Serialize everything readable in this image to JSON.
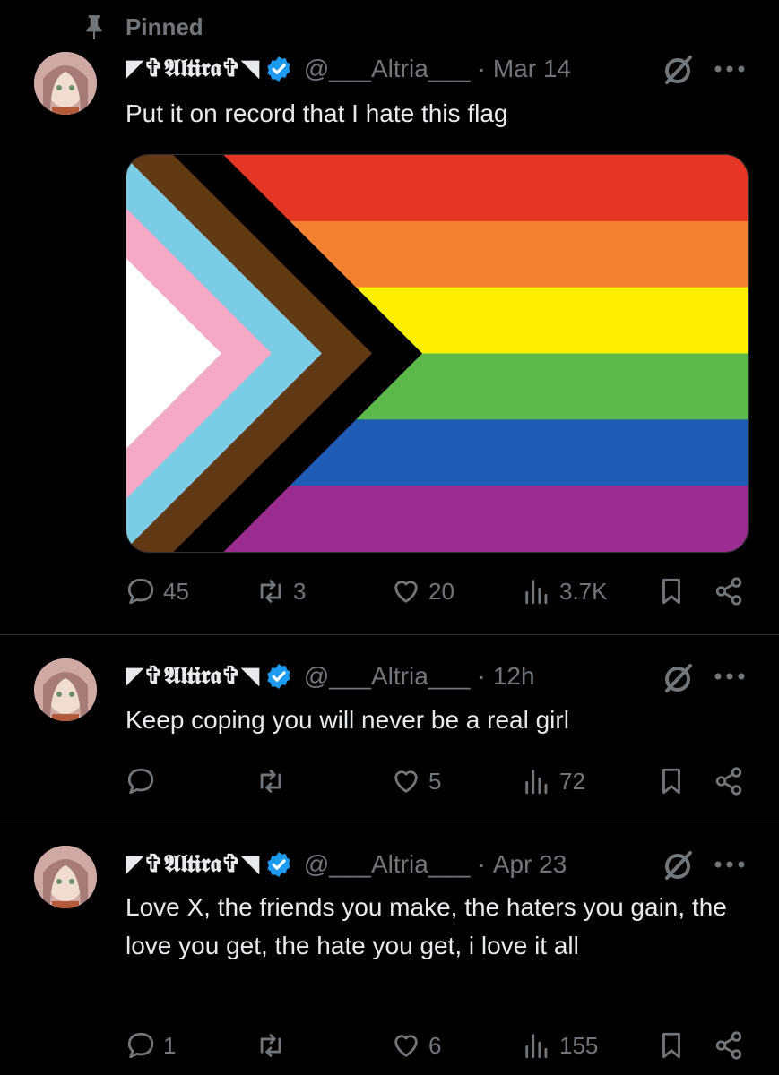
{
  "pinned_label": "Pinned",
  "colors": {
    "accent_verified": "#1d9bf0",
    "muted": "#71767b",
    "text": "#e7e9ea",
    "background": "#000000"
  },
  "flag": {
    "stripes": [
      "#e53524",
      "#f58231",
      "#ffef00",
      "#5cb848",
      "#1d5bb4",
      "#9b2b8f"
    ],
    "chevrons": [
      "#000000",
      "#613915",
      "#7bcce5",
      "#f4a9c5",
      "#ffffff"
    ]
  },
  "tweets": [
    {
      "display_name": "◤✞𝕬𝖑𝖙𝖎𝖗𝖆✞◥",
      "handle": "@___Altria___",
      "time": "Mar 14",
      "text": "Put it on record that I hate this flag",
      "replies": "45",
      "retweets": "3",
      "likes": "20",
      "views": "3.7K"
    },
    {
      "display_name": "◤✞𝕬𝖑𝖙𝖎𝖗𝖆✞◥",
      "handle": "@___Altria___",
      "time": "12h",
      "text": "Keep coping you will never be a real girl",
      "replies": "",
      "retweets": "",
      "likes": "5",
      "views": "72"
    },
    {
      "display_name": "◤✞𝕬𝖑𝖙𝖎𝖗𝖆✞◥",
      "handle": "@___Altria___",
      "time": "Apr 23",
      "text": "Love X, the friends you make, the haters you gain, the love you get, the hate you get, i love it all",
      "replies": "1",
      "retweets": "",
      "likes": "6",
      "views": "155"
    }
  ]
}
